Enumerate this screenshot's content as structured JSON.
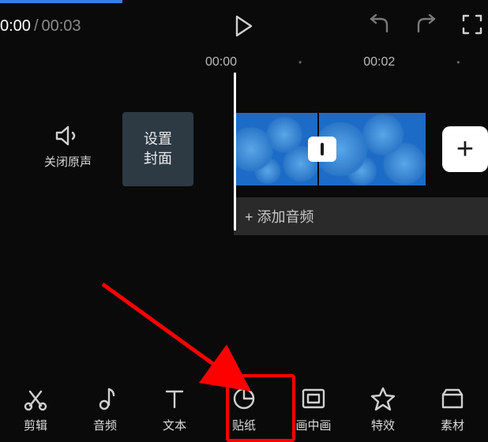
{
  "topbar": {
    "time_current": "0:00",
    "time_sep": "/",
    "time_total": "00:03"
  },
  "ruler": {
    "t0": "00:00",
    "t1": "00:02"
  },
  "left_controls": {
    "mute_label": "关闭原声",
    "cover_label": "设置\n封面"
  },
  "audio_track": {
    "add_label": "+ 添加音频"
  },
  "tabs": {
    "edit": "剪辑",
    "audio": "音频",
    "text": "文本",
    "sticker": "贴纸",
    "pip": "画中画",
    "effect": "特效",
    "material": "素材"
  }
}
